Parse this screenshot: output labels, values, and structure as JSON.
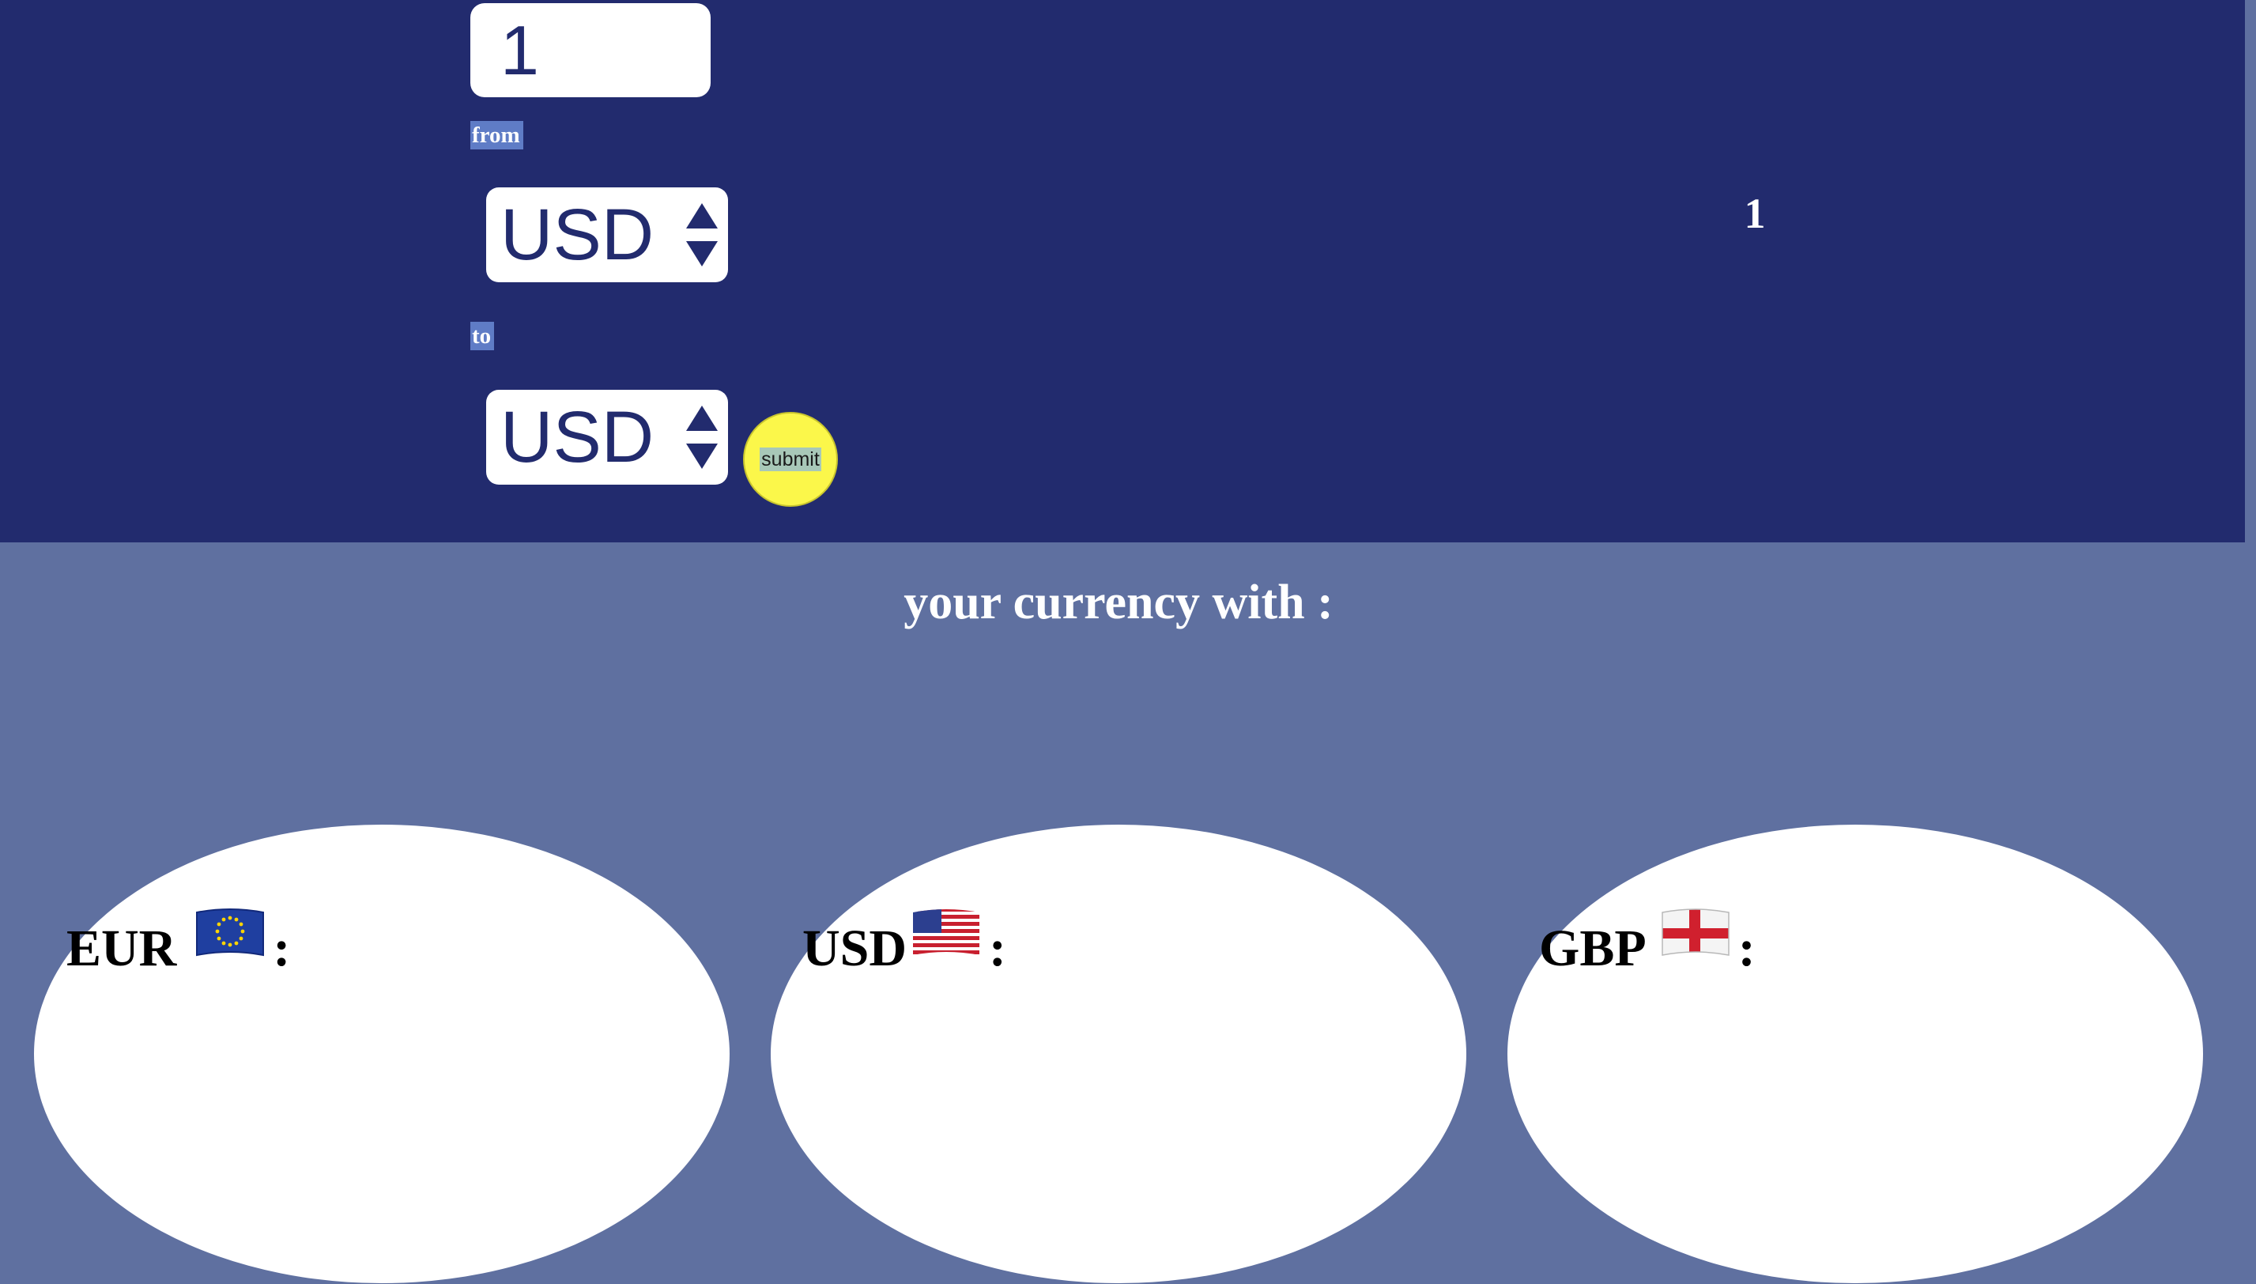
{
  "converter": {
    "amount_value": "1",
    "from_label": "from",
    "from_currency": "USD",
    "to_label": "to",
    "to_currency": "USD",
    "submit_label": "submit",
    "result": "1"
  },
  "rates": {
    "heading": "your currency with :",
    "items": [
      {
        "code": "EUR",
        "flag_icon": "eu-flag-icon",
        "separator": ":"
      },
      {
        "code": "USD",
        "flag_icon": "us-flag-icon",
        "separator": ":"
      },
      {
        "code": "GBP",
        "flag_icon": "england-flag-icon",
        "separator": ":"
      }
    ]
  },
  "colors": {
    "banner": "#222b6e",
    "background": "#5f70a0",
    "submit_button": "#fbf74a",
    "label_highlight": "#5f7cc6"
  }
}
